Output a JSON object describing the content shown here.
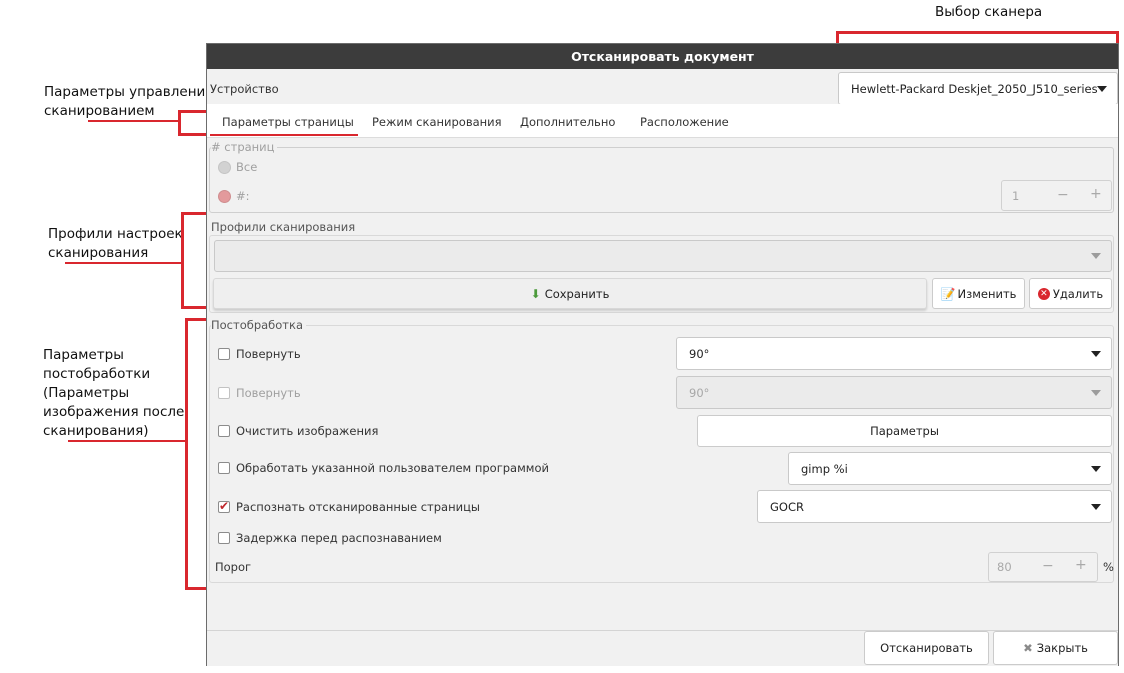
{
  "annotations": {
    "scanner_select": "Выбор сканера",
    "control_params_line1": "Параметры управления",
    "control_params_line2": "сканированием",
    "profiles_line1": "Профили настроек",
    "profiles_line2": "сканирования",
    "post_line1": "Параметры",
    "post_line2": "постобработки",
    "post_line3": "(Параметры",
    "post_line4": "изображения после",
    "post_line5": "сканирования)"
  },
  "window": {
    "title": "Отсканировать документ"
  },
  "device": {
    "label": "Устройство",
    "value": "Hewlett-Packard Deskjet_2050_J510_series"
  },
  "tabs": [
    {
      "label": "Параметры страницы"
    },
    {
      "label": "Режим сканирования"
    },
    {
      "label": "Дополнительно"
    },
    {
      "label": "Расположение"
    }
  ],
  "pages": {
    "frame_title": "# страниц",
    "all_label": "Все",
    "count_label": "#:",
    "count_value": "1",
    "minus": "−",
    "plus": "+"
  },
  "profiles": {
    "frame_title": "Профили сканирования",
    "combo_value": "",
    "save_label": "Сохранить",
    "edit_label": "Изменить",
    "delete_label": "Удалить"
  },
  "postprocess": {
    "frame_title": "Постобработка",
    "rotate1_label": "Повернуть",
    "rotate1_value": "90°",
    "rotate2_label": "Повернуть",
    "rotate2_value": "90°",
    "clean_label": "Очистить изображения",
    "params_button": "Параметры",
    "custom_label": "Обработать указанной пользователем программой",
    "custom_value": "gimp %i",
    "ocr_label": "Распознать отсканированные страницы",
    "ocr_value": "GOCR",
    "delay_label": "Задержка перед распознаванием",
    "threshold_label": "Порог",
    "threshold_value": "80",
    "minus": "−",
    "plus": "+",
    "unit": "%"
  },
  "footer": {
    "scan_label": "Отсканировать",
    "close_label": "Закрыть"
  },
  "colors": {
    "accent_red": "#d9272e",
    "titlebar": "#3c3c3c"
  }
}
